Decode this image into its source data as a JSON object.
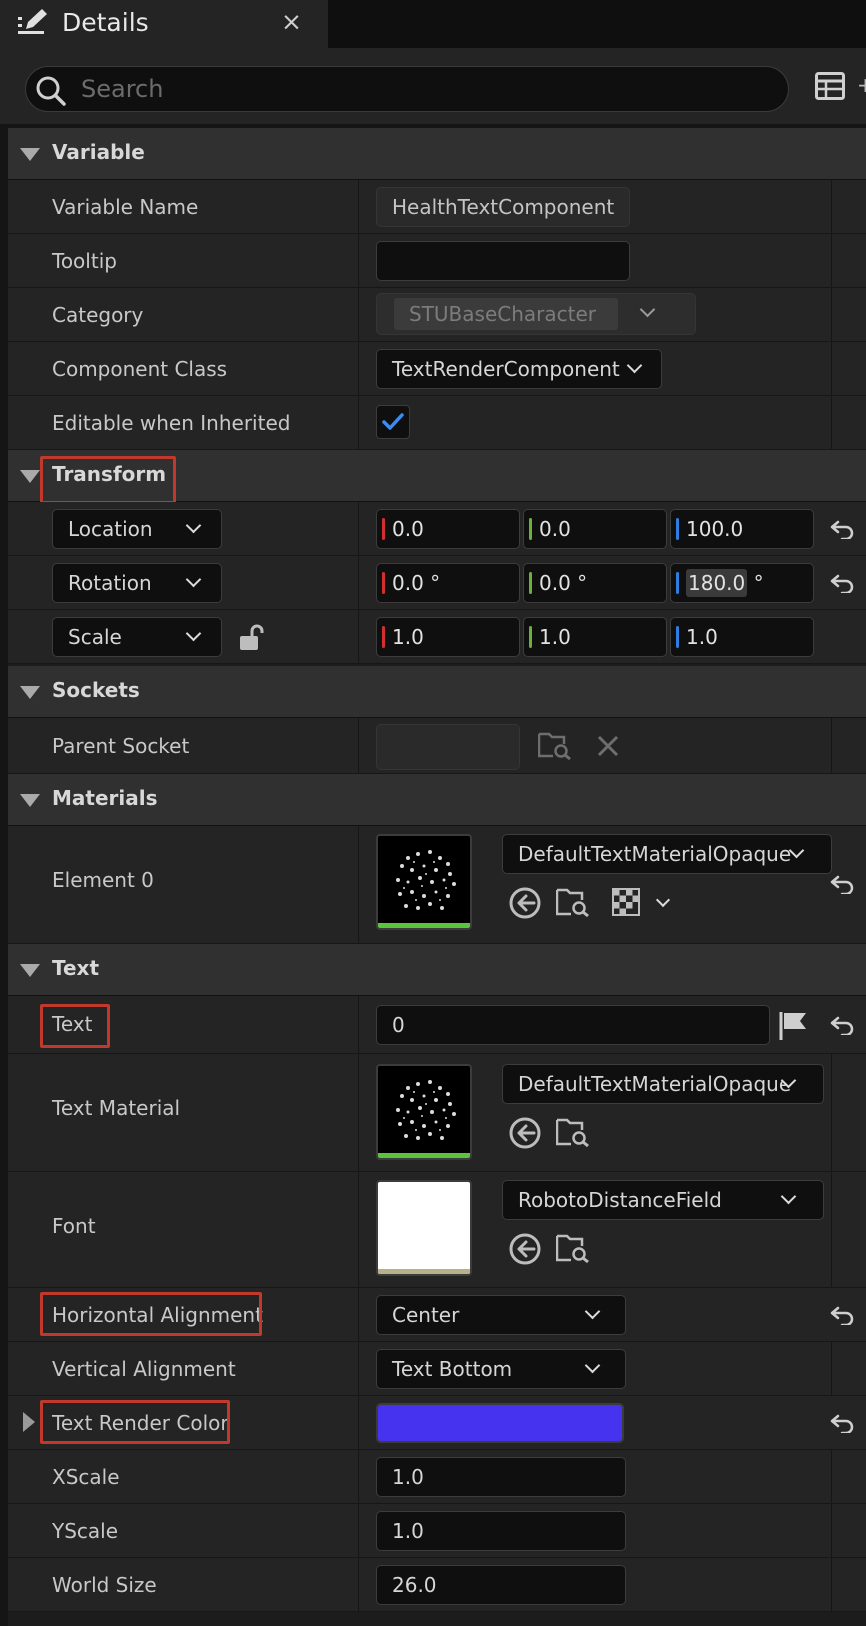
{
  "tab": {
    "title": "Details",
    "close": "×",
    "icon": "edit-icon"
  },
  "search": {
    "placeholder": "Search",
    "value": ""
  },
  "sections": {
    "variable": "Variable",
    "transform": "Transform",
    "sockets": "Sockets",
    "materials": "Materials",
    "text": "Text"
  },
  "variable": {
    "variable_name_label": "Variable Name",
    "variable_name_value": "HealthTextComponent",
    "tooltip_label": "Tooltip",
    "tooltip_value": "",
    "category_label": "Category",
    "category_value": "STUBaseCharacter",
    "component_class_label": "Component Class",
    "component_class_value": "TextRenderComponent",
    "editable_label": "Editable when Inherited",
    "editable_checked": true
  },
  "transform": {
    "location": {
      "label": "Location",
      "x": "0.0",
      "y": "0.0",
      "z": "100.0"
    },
    "rotation": {
      "label": "Rotation",
      "x": "0.0 °",
      "y": "0.0 °",
      "z_num": "180.0",
      "z_unit": " °"
    },
    "scale": {
      "label": "Scale",
      "x": "1.0",
      "y": "1.0",
      "z": "1.0"
    }
  },
  "sockets": {
    "parent_socket_label": "Parent Socket",
    "parent_socket_value": ""
  },
  "materials": {
    "element0_label": "Element 0",
    "element0_value": "DefaultTextMaterialOpaque"
  },
  "text": {
    "text_label": "Text",
    "text_value": "0",
    "text_material_label": "Text Material",
    "text_material_value": "DefaultTextMaterialOpaque",
    "font_label": "Font",
    "font_value": "RobotoDistanceField",
    "h_align_label": "Horizontal Alignment",
    "h_align_value": "Center",
    "v_align_label": "Vertical Alignment",
    "v_align_value": "Text Bottom",
    "render_color_label": "Text Render Color",
    "render_color_hex": "#4533f0",
    "xscale_label": "XScale",
    "xscale_value": "1.0",
    "yscale_label": "YScale",
    "yscale_value": "1.0",
    "world_size_label": "World Size",
    "world_size_value": "26.0"
  },
  "colors": {
    "highlight": "#c0392b",
    "axis_x": "#d13030",
    "axis_y": "#6ab03a",
    "axis_z": "#2f7de0"
  }
}
